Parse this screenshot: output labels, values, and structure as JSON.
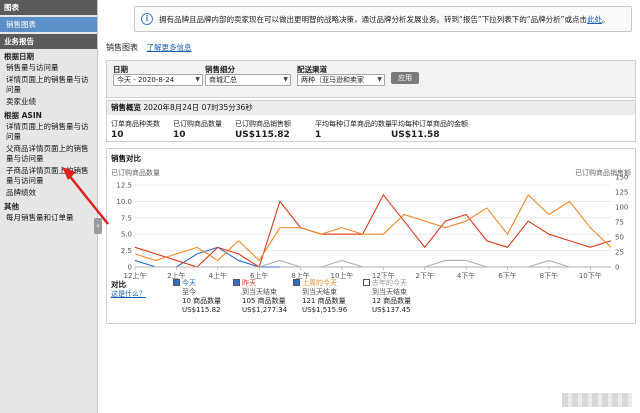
{
  "sidebar": {
    "section_top": "图表",
    "selected": "销售图表",
    "section_reports": "业务报告",
    "groups": [
      {
        "title": "根据日期",
        "items": [
          "销售量与访问量",
          "详情页面上的销售量与访问量",
          "卖家业绩"
        ]
      },
      {
        "title": "根据 ASIN",
        "items": [
          "详情页面上的销售量与访问量",
          "父商品详情页面上的销售量与访问量",
          "子商品详情页面上的销售量与访问量",
          "品牌绩效"
        ]
      },
      {
        "title": "其他",
        "items": [
          "每月销售量和订单量"
        ]
      }
    ]
  },
  "banner": {
    "text": "拥有品牌且品牌内部的卖家现在可以做出更明智的战略决策，通过品牌分析发展业务。转到“报告”下拉列表下的“品牌分析”或点击",
    "link": "此处",
    "tail": "。"
  },
  "main": {
    "title": "销售图表",
    "learn_more": "了解更多信息"
  },
  "filters": {
    "date_label": "日期",
    "date_value": "今天 - 2020-8-24",
    "subdivision_label": "销售细分",
    "subdivision_value": "商城汇总",
    "channel_label": "配送渠道",
    "channel_value": "两种（亚马逊和卖家",
    "apply": "应用"
  },
  "summary": {
    "title": "销售概览",
    "timestamp": "2020年8月24日 07时35分36秒",
    "metrics": [
      {
        "label": "订单商品种类数",
        "value": "10"
      },
      {
        "label": "已订购商品数量",
        "value": "10"
      },
      {
        "label": "已订购商品销售额",
        "value": "US$115.82"
      },
      {
        "label": "平均每种订单商品的数量",
        "value": "1"
      },
      {
        "label": "平均每种订单商品的金额",
        "value": "US$11.58"
      }
    ]
  },
  "compare": {
    "title": "销售对比",
    "left_axis_title": "已订购商品数量",
    "right_axis_title": "已订购商品销售额",
    "left_ticks": [
      "12.5",
      "10.0",
      "7.5",
      "5.0",
      "2.5",
      "0"
    ],
    "right_ticks": [
      "150",
      "125",
      "100",
      "75",
      "50",
      "25",
      "0"
    ],
    "x_ticks": [
      "12上午",
      "2上午",
      "4上午",
      "6上午",
      "8上午",
      "10上午",
      "12下午",
      "2下午",
      "4下午",
      "6下午",
      "8下午",
      "10下午"
    ],
    "label": "对比",
    "what_link": "这是什么？",
    "columns": [
      {
        "name": "今天",
        "range": "至今",
        "items": "10 商品数量",
        "sales": "US$115.82",
        "color": "#2d6fc7",
        "checked": true
      },
      {
        "name": "昨天",
        "range": "到当天结束",
        "items": "105 商品数量",
        "sales": "US$1,277.34",
        "color": "#d83a20",
        "checked": true
      },
      {
        "name": "上周的今天",
        "range": "到当天结束",
        "items": "121 商品数量",
        "sales": "US$1,515.96",
        "color": "#f08a2a",
        "checked": true
      },
      {
        "name": "去年的今天",
        "range": "到当天结束",
        "items": "12 商品数量",
        "sales": "US$137.45",
        "color": "#9a9a9a",
        "checked": false
      }
    ]
  },
  "chart_data": {
    "type": "line",
    "x": [
      0,
      1,
      2,
      3,
      4,
      5,
      6,
      7,
      8,
      9,
      10,
      11,
      12,
      13,
      14,
      15,
      16,
      17,
      18,
      19,
      20,
      21,
      22,
      23
    ],
    "ylabel": "已订购商品数量",
    "ylim": [
      0,
      12.5
    ],
    "series": [
      {
        "name": "今天",
        "color": "#2d6fc7",
        "values": [
          1,
          0,
          0,
          2,
          3,
          1,
          0,
          0
        ]
      },
      {
        "name": "昨天",
        "color": "#d83a20",
        "values": [
          3,
          2,
          1,
          0,
          3,
          2,
          0,
          10,
          6,
          5,
          5,
          5,
          11,
          7,
          3,
          7,
          8,
          4,
          3,
          7,
          5,
          4,
          3,
          4
        ]
      },
      {
        "name": "上周的今天",
        "color": "#f08a2a",
        "values": [
          2,
          1,
          2,
          3,
          1,
          4,
          1,
          6,
          6,
          5,
          6,
          5,
          5,
          8,
          7,
          6,
          7,
          9,
          5,
          11,
          8,
          10,
          6,
          3
        ]
      },
      {
        "name": "去年的今天",
        "color": "#b0b0b0",
        "values": [
          0,
          0,
          0,
          0,
          0,
          0,
          0,
          1,
          0,
          0,
          1,
          0,
          0,
          0,
          0,
          1,
          1,
          0,
          0,
          0,
          1,
          0,
          0,
          0
        ]
      }
    ]
  }
}
